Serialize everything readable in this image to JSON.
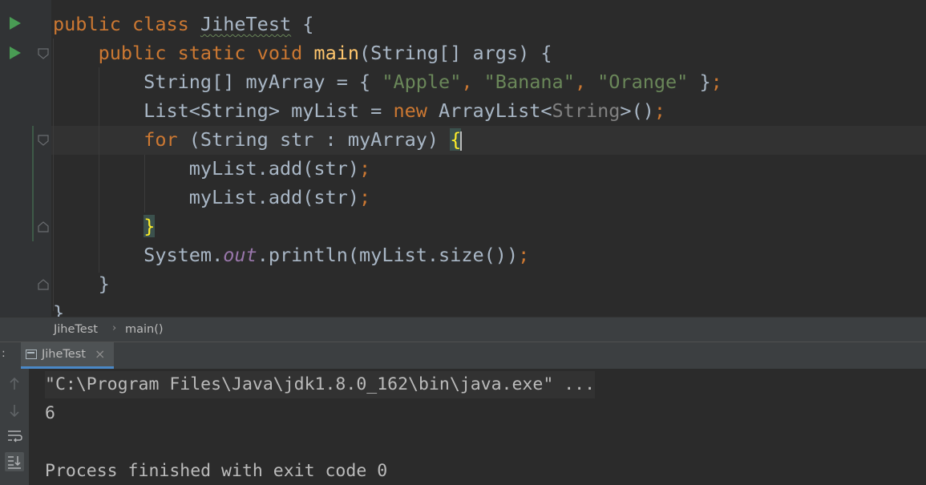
{
  "editor": {
    "lines": [
      {
        "tokens": [
          {
            "t": "public class ",
            "c": "kw"
          },
          {
            "t": "JiheTest",
            "c": "squig"
          },
          {
            "t": " {",
            "c": ""
          }
        ]
      },
      {
        "tokens": [
          {
            "t": "    ",
            "c": ""
          },
          {
            "t": "public static void ",
            "c": "kw"
          },
          {
            "t": "main",
            "c": "fn"
          },
          {
            "t": "(String[] args) {",
            "c": ""
          }
        ]
      },
      {
        "tokens": [
          {
            "t": "        String[] myArray = { ",
            "c": ""
          },
          {
            "t": "\"Apple\"",
            "c": "str"
          },
          {
            "t": ", ",
            "c": "kw"
          },
          {
            "t": "\"Banana\"",
            "c": "str"
          },
          {
            "t": ", ",
            "c": "kw"
          },
          {
            "t": "\"Orange\"",
            "c": "str"
          },
          {
            "t": " }",
            "c": ""
          },
          {
            "t": ";",
            "c": "kw"
          }
        ]
      },
      {
        "tokens": [
          {
            "t": "        List<String> myList = ",
            "c": ""
          },
          {
            "t": "new ",
            "c": "kw"
          },
          {
            "t": "ArrayList<",
            "c": ""
          },
          {
            "t": "String",
            "c": "gen"
          },
          {
            "t": ">()",
            "c": ""
          },
          {
            "t": ";",
            "c": "kw"
          }
        ]
      },
      {
        "tokens": [
          {
            "t": "        ",
            "c": ""
          },
          {
            "t": "for ",
            "c": "kw"
          },
          {
            "t": "(String str : myArray) ",
            "c": ""
          },
          {
            "t": "{",
            "c": "brace"
          },
          {
            "t": "",
            "c": "caret"
          }
        ]
      },
      {
        "tokens": [
          {
            "t": "            myList.add(str)",
            "c": ""
          },
          {
            "t": ";",
            "c": "kw"
          }
        ]
      },
      {
        "tokens": [
          {
            "t": "            myList.add(str)",
            "c": ""
          },
          {
            "t": ";",
            "c": "kw"
          }
        ]
      },
      {
        "tokens": [
          {
            "t": "        ",
            "c": ""
          },
          {
            "t": "}",
            "c": "brace"
          }
        ]
      },
      {
        "tokens": [
          {
            "t": "        System.",
            "c": ""
          },
          {
            "t": "out",
            "c": "fld"
          },
          {
            "t": ".println(myList.size())",
            "c": ""
          },
          {
            "t": ";",
            "c": "kw"
          }
        ]
      },
      {
        "tokens": [
          {
            "t": "    }",
            "c": ""
          }
        ]
      },
      {
        "tokens": [
          {
            "t": "}",
            "c": ""
          }
        ]
      }
    ]
  },
  "breadcrumb": {
    "class_name": "JiheTest",
    "separator": "›",
    "method_name": "main()"
  },
  "run_panel": {
    "side_label": ":",
    "tab_label": "JiheTest",
    "tab_close": "×",
    "console_lines": [
      "\"C:\\Program Files\\Java\\jdk1.8.0_162\\bin\\java.exe\" ...",
      "6",
      "",
      "Process finished with exit code 0"
    ]
  },
  "icons": {
    "run_class": "run-arrow-icon",
    "run_main": "run-arrow-icon",
    "console_tools": [
      "arrow-up-icon",
      "arrow-down-icon",
      "soft-wrap-icon",
      "scroll-to-end-icon"
    ]
  },
  "colors": {
    "background": "#2b2b2b",
    "keyword": "#cc7832",
    "string": "#6a8759",
    "function": "#ffc66d",
    "field": "#9876aa",
    "text": "#a9b7c6",
    "run_icon": "#499c54"
  }
}
